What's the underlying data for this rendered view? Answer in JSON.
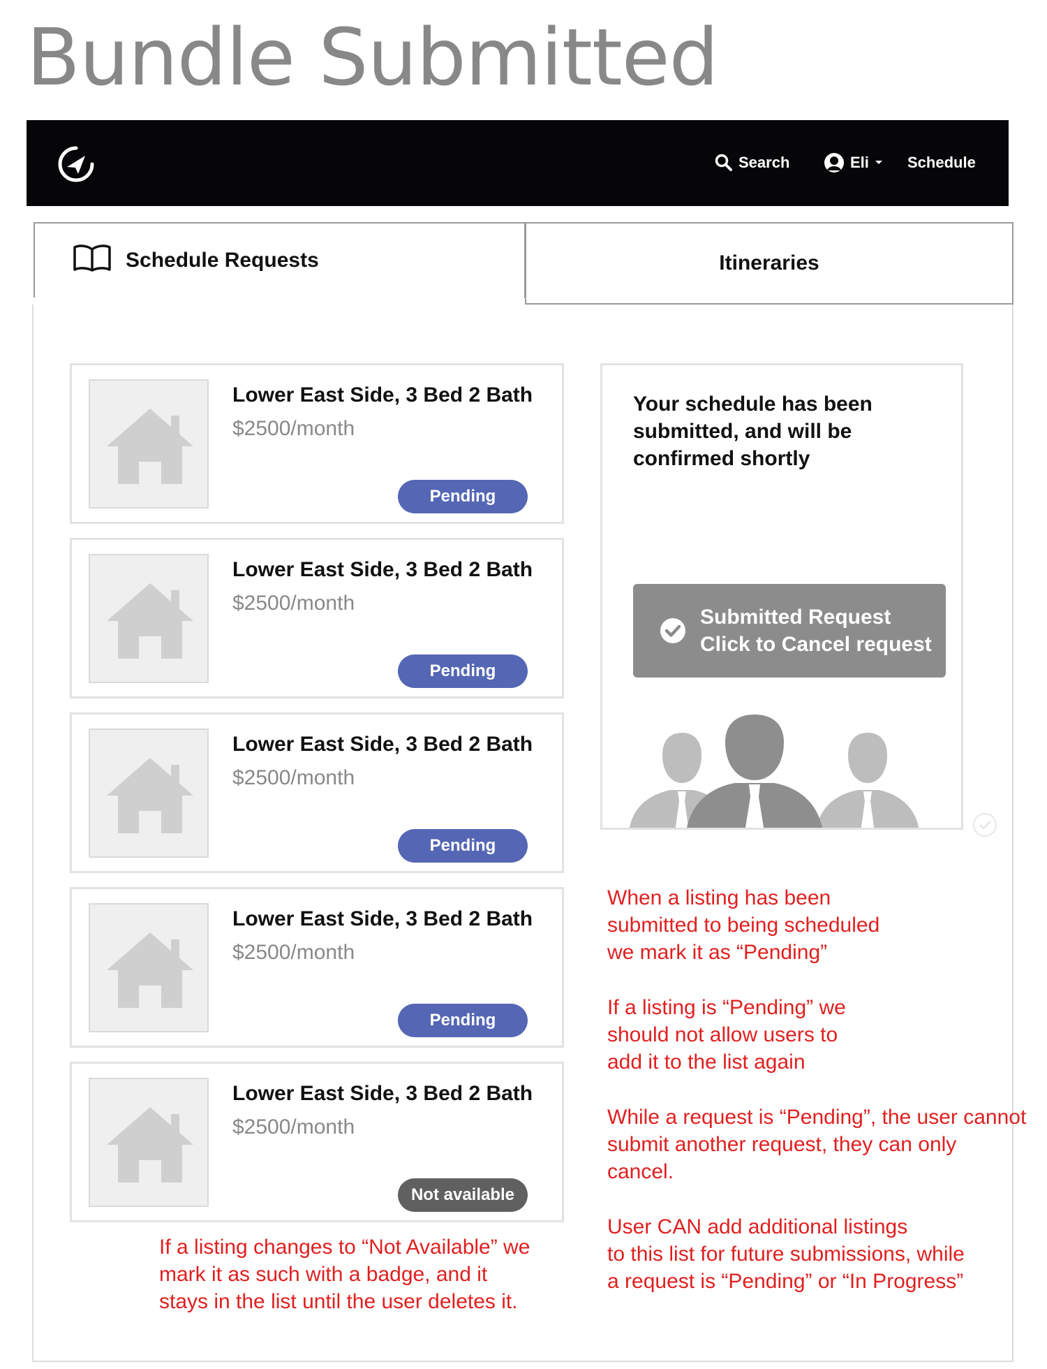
{
  "page": {
    "title": "Bundle Submitted"
  },
  "navbar": {
    "search_label": "Search",
    "user_name": "Eli",
    "schedule_label": "Schedule"
  },
  "tabs": {
    "requests_label": "Schedule Requests",
    "itineraries_label": "Itineraries"
  },
  "listings": [
    {
      "title": "Lower East Side, 3 Bed 2 Bath",
      "price": "$2500/month",
      "status": "Pending"
    },
    {
      "title": "Lower East Side, 3 Bed 2 Bath",
      "price": "$2500/month",
      "status": "Pending"
    },
    {
      "title": "Lower East Side, 3 Bed 2 Bath",
      "price": "$2500/month",
      "status": "Pending"
    },
    {
      "title": "Lower East Side, 3 Bed 2 Bath",
      "price": "$2500/month",
      "status": "Pending"
    },
    {
      "title": "Lower East Side, 3 Bed 2 Bath",
      "price": "$2500/month",
      "status": "Not available"
    }
  ],
  "confirmation": {
    "message_lines": [
      "Your schedule has been",
      "submitted, and will be",
      "confirmed shortly"
    ],
    "button_line1": "Submitted Request",
    "button_line2": "Click to Cancel request"
  },
  "annotations": {
    "pending_note": [
      "When a listing has been",
      "submitted to being scheduled",
      "we mark it as “Pending”"
    ],
    "no_readd_note": [
      "If a listing is “Pending” we",
      "should not allow users to",
      "add it to the list again"
    ],
    "cancel_only_note": [
      "While a request is “Pending”, the user cannot",
      "submit another request, they can only",
      "cancel."
    ],
    "add_more_note": [
      "User CAN add additional listings",
      "to this list for future submissions, while",
      "a request is “Pending” or “In Progress”"
    ],
    "not_available_note": [
      "If a listing changes to “Not Available” we",
      "mark it as such with a badge, and it",
      "stays in the list until the user deletes it."
    ]
  },
  "colors": {
    "pending_badge": "#5466b4",
    "unavailable_badge": "#606060",
    "annotation_text": "#e02020",
    "navbar_bg": "#060608"
  }
}
